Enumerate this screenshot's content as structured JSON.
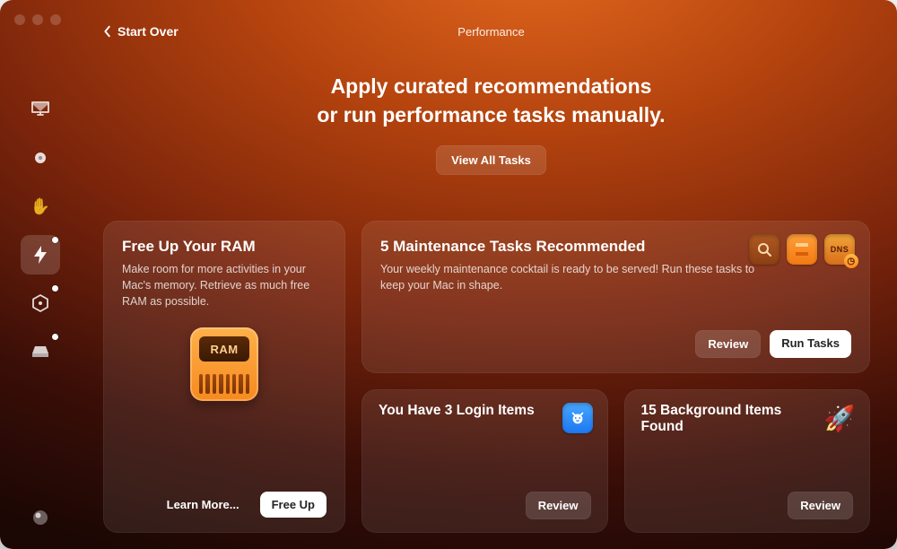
{
  "header": {
    "back_label": "Start Over",
    "title": "Performance"
  },
  "hero": {
    "line1": "Apply curated recommendations",
    "line2": "or run performance tasks manually.",
    "view_all": "View All Tasks"
  },
  "sidebar": {
    "items": [
      {
        "name": "cleanup",
        "icon": "mac-icon",
        "active": false,
        "dot": false
      },
      {
        "name": "protection",
        "icon": "shield-dot-icon",
        "active": false,
        "dot": false
      },
      {
        "name": "privacy",
        "icon": "hand-icon",
        "active": false,
        "dot": false
      },
      {
        "name": "performance",
        "icon": "bolt-icon",
        "active": true,
        "dot": true
      },
      {
        "name": "apps",
        "icon": "hex-icon",
        "active": false,
        "dot": true
      },
      {
        "name": "files",
        "icon": "drive-icon",
        "active": false,
        "dot": true
      }
    ],
    "bottom": {
      "name": "assistant",
      "icon": "orb-icon"
    }
  },
  "cards": {
    "ram": {
      "title": "Free Up Your RAM",
      "desc": "Make room for more activities in your Mac's memory. Retrieve as much free RAM as possible.",
      "chip_label": "RAM",
      "learn": "Learn More...",
      "action": "Free Up"
    },
    "maintenance": {
      "title": "5 Maintenance Tasks Recommended",
      "desc": "Your weekly maintenance cocktail is ready to be served! Run these tasks to keep your Mac in shape.",
      "review": "Review",
      "action": "Run Tasks",
      "dns_label": "DNS"
    },
    "login": {
      "title": "You Have 3 Login Items",
      "review": "Review"
    },
    "background": {
      "title": "15 Background Items Found",
      "review": "Review"
    }
  }
}
